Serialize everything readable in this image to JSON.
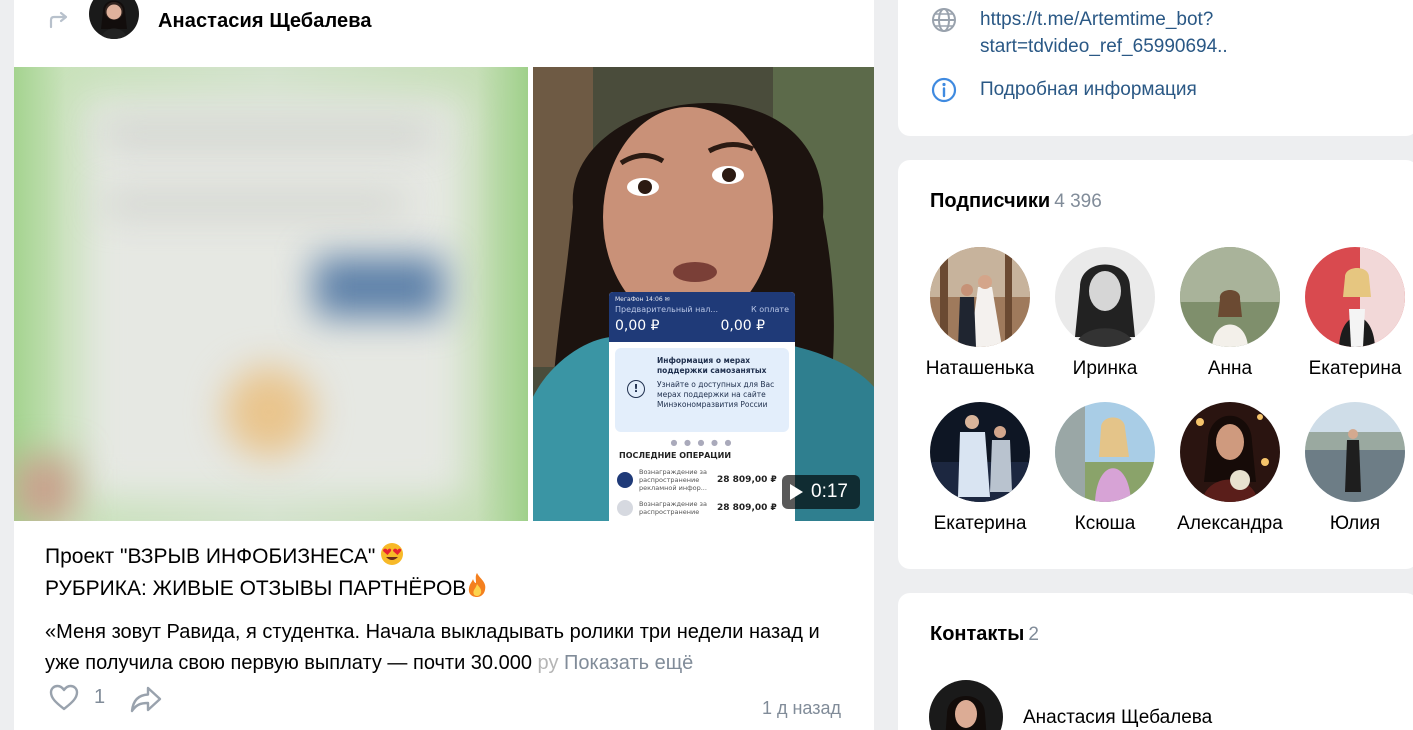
{
  "post": {
    "author_name": "Анастасия Щебалева",
    "video_duration": "0:17",
    "phone_screen": {
      "status": "МегаФон 14:06 ✉",
      "sub_left": "Предварительный нал...",
      "sub_right": "К оплате",
      "amount_left": "0,00 ₽",
      "amount_right": "0,00 ₽",
      "card_title": "Информация о мерах поддержки самозанятых",
      "card_text": "Узнайте о доступных для Вас мерах поддержки на сайте Минэкономразвития России",
      "dots": "● ● ● ● ●",
      "ops_header": "ПОСЛЕДНИЕ ОПЕРАЦИИ",
      "ops": [
        {
          "text": "Вознаграждение за распространение рекламной инфор...",
          "amount": "28 809,00 ₽"
        },
        {
          "text": "Вознаграждение за распространение",
          "amount": "28 809,00 ₽"
        }
      ]
    },
    "title_line1": "Проект \"ВЗРЫВ ИНФОБИЗНЕСА\"",
    "title_line2": "РУБРИКА: ЖИВЫЕ ОТЗЫВЫ ПАРТНЁРОВ",
    "body_text": "«Меня зовут Равида, я студентка. Начала выкладывать ролики три недели назад и уже получила свою первую выплату — почти 30.000",
    "body_fade": " ру",
    "show_more": "Показать ещё",
    "likes_count": "1",
    "time": "1 д назад"
  },
  "info": {
    "link_line1": "https://t.me/Artemtime_bot?",
    "link_line2": "start=tdvideo_ref_65990694..",
    "more_info": "Подробная информация"
  },
  "subscribers": {
    "title": "Подписчики",
    "count": "4 396",
    "people": [
      {
        "name": "Наташенька"
      },
      {
        "name": "Иринка"
      },
      {
        "name": "Анна"
      },
      {
        "name": "Екатерина"
      },
      {
        "name": "Екатерина"
      },
      {
        "name": "Ксюша"
      },
      {
        "name": "Александра"
      },
      {
        "name": "Юлия"
      }
    ]
  },
  "contacts": {
    "title": "Контакты",
    "count": "2",
    "first_contact_name": "Анастасия Щебалева"
  },
  "colors": {
    "link": "#2a5885",
    "secondary_text": "#818c99",
    "background": "#edeef0"
  }
}
